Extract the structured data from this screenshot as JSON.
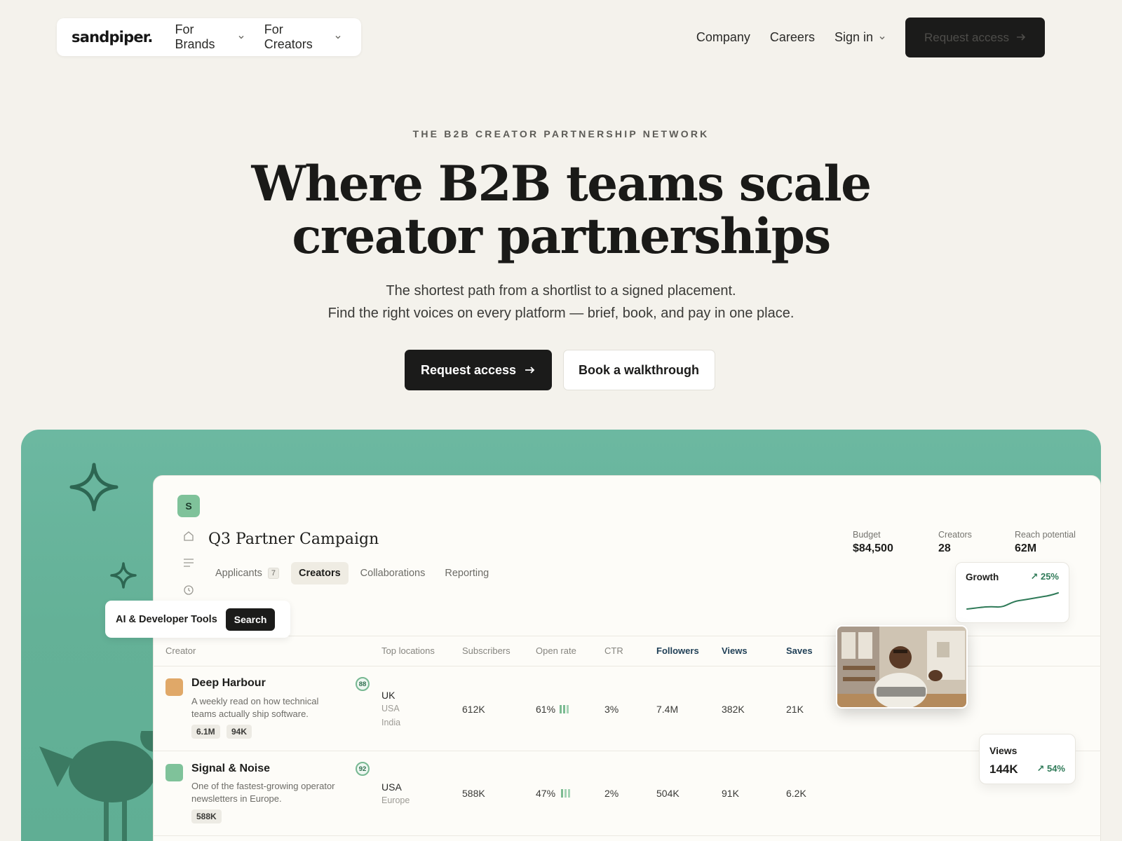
{
  "nav": {
    "logo": "sandpiper.",
    "left_links": [
      "For Brands",
      "For Creators"
    ],
    "right_links": [
      "Company",
      "Careers",
      "Sign in"
    ],
    "cta": "Request access"
  },
  "hero": {
    "eyebrow": "THE B2B CREATOR PARTNERSHIP NETWORK",
    "headline_line1": "Where B2B teams scale",
    "headline_line2": "creator partnerships",
    "sub_line1": "The shortest path from a shortlist to a signed placement.",
    "sub_line2": "Find the right voices on every platform — brief, book, and pay in one place.",
    "primary_cta": "Request access",
    "secondary_cta": "Book a walkthrough"
  },
  "dashboard": {
    "workspace_initial": "S",
    "campaign_title": "Q3 Partner Campaign",
    "tabs": [
      {
        "label": "Applicants",
        "count": "7"
      },
      {
        "label": "Creators"
      },
      {
        "label": "Collaborations"
      },
      {
        "label": "Reporting"
      }
    ],
    "stats": [
      {
        "label": "Budget",
        "value": "$84,500"
      },
      {
        "label": "Creators",
        "value": "28"
      },
      {
        "label": "Reach potential",
        "value": "62M"
      }
    ],
    "growth": {
      "label": "Growth",
      "change": "↗ 25%"
    },
    "category_chip": {
      "label": "AI & Developer Tools",
      "button": "Search"
    },
    "columns": [
      "Creator",
      "Top locations",
      "Subscribers",
      "Open rate",
      "CTR",
      "Followers",
      "Views",
      "Saves"
    ],
    "rows": [
      {
        "name": "Deep Harbour",
        "desc": "A weekly read on how technical teams actually ship software.",
        "score": "88",
        "pills": [
          "6.1M",
          "94K"
        ],
        "loc_main": "UK",
        "loc_sub": [
          "USA",
          "India"
        ],
        "subscribers": "612K",
        "open_rate": "61%",
        "ctr": "3%",
        "followers": "7.4M",
        "views": "382K",
        "saves": "21K",
        "color": "#e0a868"
      },
      {
        "name": "Signal & Noise",
        "desc": "One of the fastest-growing operator newsletters in Europe.",
        "score": "92",
        "pills": [
          "588K"
        ],
        "loc_main": "USA",
        "loc_sub": [
          "Europe"
        ],
        "subscribers": "588K",
        "open_rate": "47%",
        "ctr": "2%",
        "followers": "504K",
        "views": "91K",
        "saves": "6.2K",
        "color": "#7fc29a"
      }
    ],
    "views_card": {
      "label": "Views",
      "value": "144K",
      "change": "↗ 54%"
    }
  },
  "colors": {
    "background": "#f4f2ec",
    "showcase": "#64b197",
    "primary_button": "#1b1b1a",
    "accent_green": "#2f7a58"
  }
}
